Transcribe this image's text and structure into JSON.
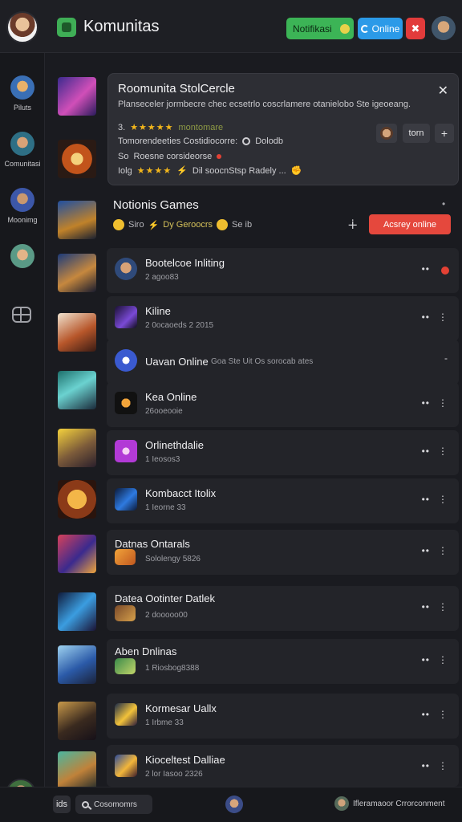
{
  "header": {
    "title": "Komunitas",
    "notif_label": "Notifikasi",
    "online_label": "Online",
    "red_icon": "close-icon"
  },
  "sidebar": {
    "items": [
      {
        "label": "Piluts"
      },
      {
        "label": "Comunitasi"
      },
      {
        "label": "Moonimg"
      },
      {
        "label": ""
      }
    ]
  },
  "info_panel": {
    "title": "Roomunita StolCercle",
    "description": "Planseceler jormbecre chec ecsetrlo coscrlamere otanielobo Ste igeoeang.",
    "row1_prefix": "3.",
    "row1_stars": "★★★★★",
    "row1_text": "montomare",
    "row2_text": "Tomorendeeties Costidiocorre:",
    "row2_tail": "Dolodb",
    "row3_prefix": "So",
    "row3_text": "Roesne corsideorse",
    "row4_prefix": "Iolg",
    "row4_stars": "★★★★",
    "row4_text": "Dil soocnStsp Radely ...",
    "button_label": "torn"
  },
  "section": {
    "title": "Notionis Games",
    "meta_a": "Siro",
    "meta_b": "Dy Geroocrs",
    "meta_c": "Se ib",
    "button_label": "Acsrey online"
  },
  "rows": [
    {
      "name": "Bootelcoe Inliting",
      "sub": "2 agoo83"
    },
    {
      "name": "Kiline",
      "sub": "2 0ocaoeds 2 2015"
    },
    {
      "name": "Uavan Online",
      "sub": "Goa Ste Uit Os sorocab ates"
    },
    {
      "name": "Kea Online",
      "sub": "26ooeooie"
    },
    {
      "name": "Orlinethdalie",
      "sub": "1 Ieosos3"
    },
    {
      "name": "Kombacct Itolix",
      "sub": "1 Ieorne 33"
    },
    {
      "name": "Datnas Ontarals",
      "sub": "Sololengy 5826"
    },
    {
      "name": "Datea Ootinter Datlek",
      "sub": "2 dooooo00"
    },
    {
      "name": "Aben Dnlinas",
      "sub": "1 Riosbog8388"
    },
    {
      "name": "Kormesar Uallx",
      "sub": "1 Irbme 33"
    },
    {
      "name": "Kioceltest Dalliae",
      "sub": "2 lor Iasoo 2326"
    }
  ],
  "bottombar": {
    "icon_label": "ids",
    "search_label": "Cosomomrs",
    "right_text": "Ifleramaoor Crrorconment"
  },
  "colors": {
    "accent_green": "#3cb456",
    "accent_blue": "#2b9ae8",
    "accent_red": "#e5483d",
    "star": "#f2b61c"
  }
}
